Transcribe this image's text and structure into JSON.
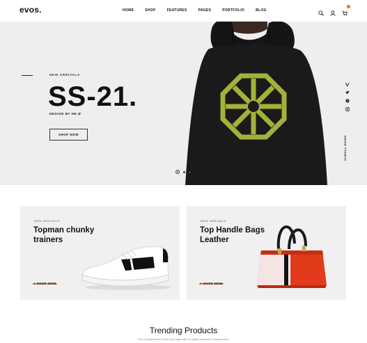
{
  "header": {
    "logo": "evos.",
    "nav": [
      "HOME",
      "SHOP",
      "FEATURES",
      "PAGES",
      "PORTFOLIO",
      "BLOG"
    ],
    "icons": [
      "search-icon",
      "user-icon",
      "cart-icon"
    ],
    "accent_color": "#e8702e"
  },
  "hero": {
    "kicker": "NEW ARRIVALS",
    "title": "SS-21.",
    "subtitle": "DESIGN BY HE.Ø",
    "button": "SHOP NOW",
    "slides_total": 3,
    "active_slide": 1,
    "social_icons": [
      "vine-icon",
      "twitter-icon",
      "pinterest-icon",
      "instagram-icon"
    ],
    "scroll_label": "SCROLL DOWN",
    "background": "#eeeeee"
  },
  "promos": [
    {
      "kicker": "NEW ARRIVALS",
      "title": "Topman chunky trainers",
      "link": "+ SHOP NOW"
    },
    {
      "kicker": "NEW ARRIVALS",
      "title": "Top Handle Bags Leather",
      "link": "+ SHOP NOW"
    }
  ],
  "trending": {
    "title": "Trending Products",
    "subtitle": "Find a bright ideal to suit your taste with our great selection of suspension."
  }
}
